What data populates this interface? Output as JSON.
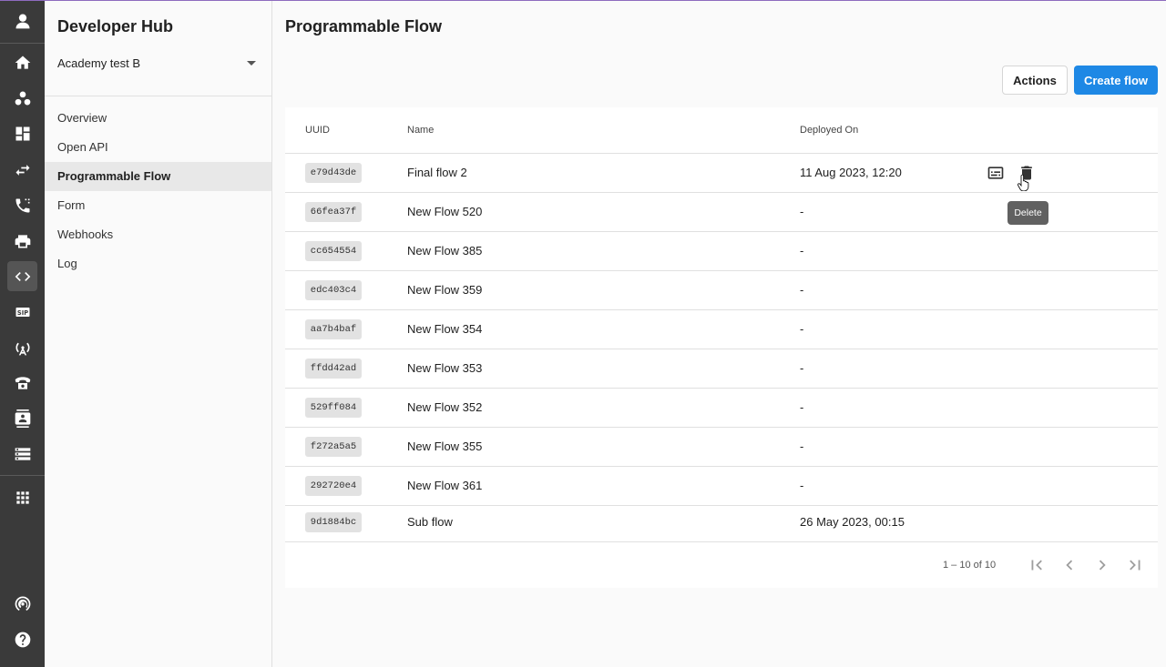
{
  "sidebar": {
    "title": "Developer Hub",
    "account": "Academy test B",
    "items": [
      {
        "label": "Overview",
        "active": false
      },
      {
        "label": "Open API",
        "active": false
      },
      {
        "label": "Programmable Flow",
        "active": true
      },
      {
        "label": "Form",
        "active": false
      },
      {
        "label": "Webhooks",
        "active": false
      },
      {
        "label": "Log",
        "active": false
      }
    ]
  },
  "rail": {
    "icons": [
      "avatar-icon",
      "home-icon",
      "people-icon",
      "dashboard-icon",
      "transfer-icon",
      "phone-forward-icon",
      "printer-icon",
      "code-icon",
      "sip-icon",
      "antenna-icon",
      "telephone-icon",
      "contact-card-icon",
      "server-icon",
      "apps-grid-icon",
      "broadcast-icon",
      "help-icon"
    ],
    "sip_label": "SIP"
  },
  "main": {
    "title": "Programmable Flow",
    "actions_label": "Actions",
    "create_label": "Create flow",
    "columns": {
      "uuid": "UUID",
      "name": "Name",
      "deployed": "Deployed On"
    },
    "rows": [
      {
        "uuid": "e79d43de",
        "name": "Final flow 2",
        "deployed": "11 Aug 2023, 12:20"
      },
      {
        "uuid": "66fea37f",
        "name": "New Flow 520",
        "deployed": "-"
      },
      {
        "uuid": "cc654554",
        "name": "New Flow 385",
        "deployed": "-"
      },
      {
        "uuid": "edc403c4",
        "name": "New Flow 359",
        "deployed": "-"
      },
      {
        "uuid": "aa7b4baf",
        "name": "New Flow 354",
        "deployed": "-"
      },
      {
        "uuid": "ffdd42ad",
        "name": "New Flow 353",
        "deployed": "-"
      },
      {
        "uuid": "529ff084",
        "name": "New Flow 352",
        "deployed": "-"
      },
      {
        "uuid": "f272a5a5",
        "name": "New Flow 355",
        "deployed": "-"
      },
      {
        "uuid": "292720e4",
        "name": "New Flow 361",
        "deployed": "-"
      },
      {
        "uuid": "9d1884bc",
        "name": "Sub flow",
        "deployed": "26 May 2023, 00:15"
      }
    ],
    "pagination": "1 – 10 of 10",
    "tooltip": "Delete"
  },
  "colors": {
    "rail": "#3a3a3a",
    "accent": "#1e88e5",
    "tooltip": "#616161"
  }
}
